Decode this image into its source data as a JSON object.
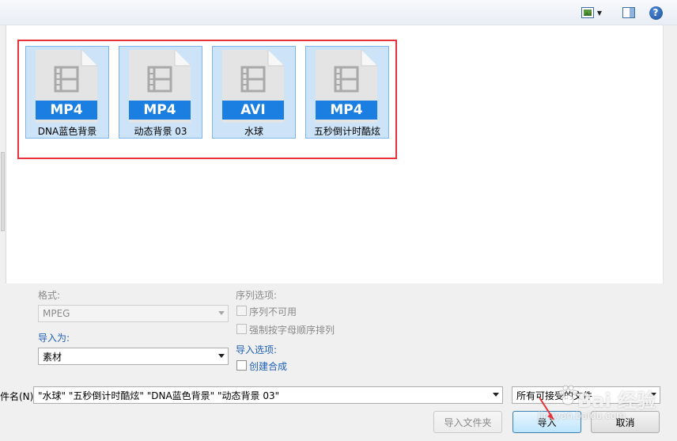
{
  "files": [
    {
      "badge": "MP4",
      "name": "DNA蓝色背景"
    },
    {
      "badge": "MP4",
      "name": "动态背景 03"
    },
    {
      "badge": "AVI",
      "name": "水球"
    },
    {
      "badge": "MP4",
      "name": "五秒倒计时酷炫"
    }
  ],
  "options": {
    "format_label": "格式:",
    "format_value": "MPEG",
    "import_as_label": "导入为:",
    "import_as_value": "素材",
    "sequence_options_label": "序列选项:",
    "sequence_unavailable": "序列不可用",
    "force_alpha_order": "强制按字母顺序排列",
    "import_options_label": "导入选项:",
    "create_composition": "创建合成"
  },
  "filename": {
    "label": "件名(N):",
    "value": "\"水球\" \"五秒倒计时酷炫\" \"DNA蓝色背景\" \"动态背景 03\"",
    "filter_value": "所有可接受的文件"
  },
  "buttons": {
    "import_folder": "导入文件夹",
    "import": "导入",
    "cancel": "取消"
  },
  "watermark": {
    "text": "Bai 经验",
    "sub": "jingyan.baidu.com"
  },
  "colors": {
    "selection_frame": "#e8313a",
    "badge_blue": "#1a7fe0",
    "item_selected": "#cde3f7"
  }
}
